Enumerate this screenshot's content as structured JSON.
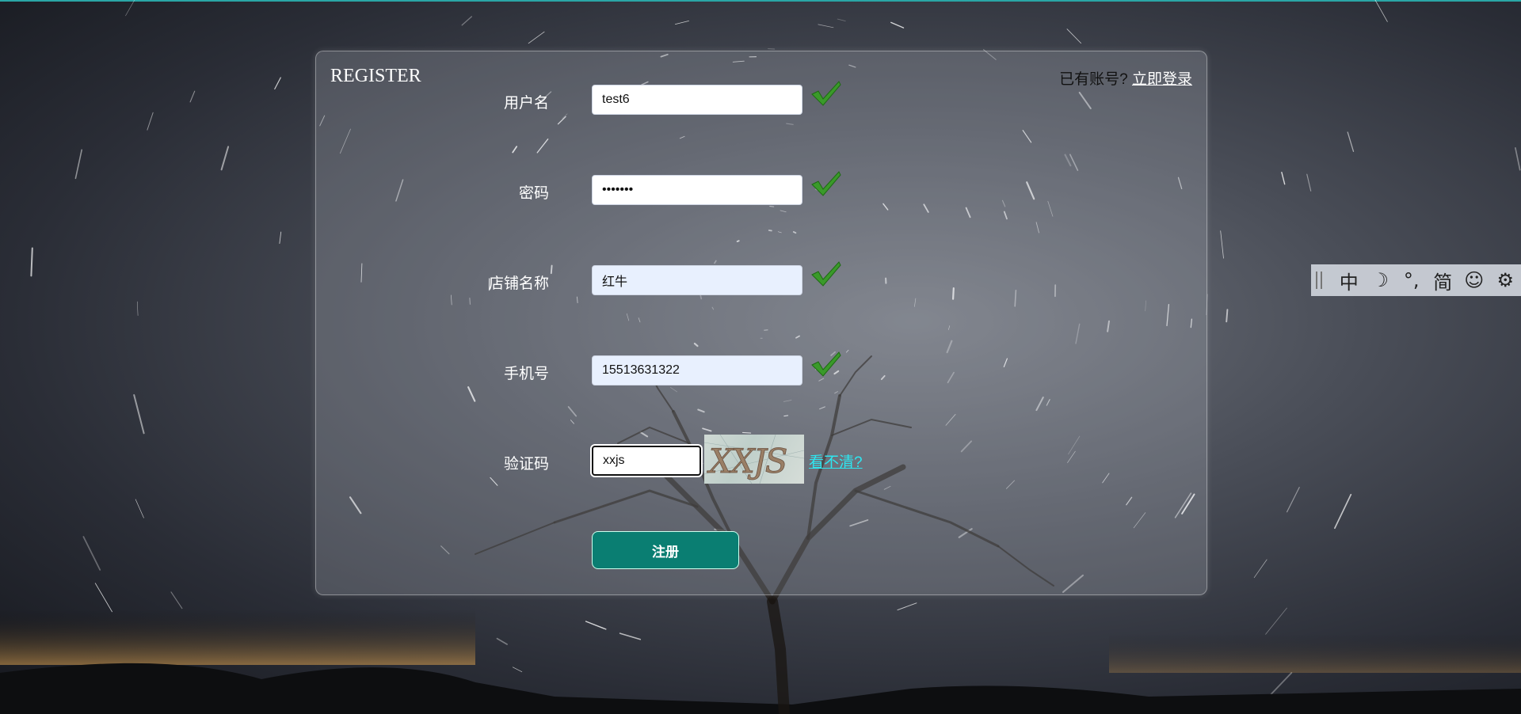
{
  "page": {
    "title": "REGISTER",
    "have_account_text": "已有账号?",
    "login_link": "立即登录"
  },
  "form": {
    "username": {
      "label": "用户名",
      "value": "test6",
      "valid": true
    },
    "password": {
      "label": "密码",
      "value": "•••••••",
      "valid": true
    },
    "shop_name": {
      "label": "店铺名称",
      "value": "红牛",
      "valid": true
    },
    "phone": {
      "label": "手机号",
      "value": "15513631322",
      "valid": true
    },
    "captcha": {
      "label": "验证码",
      "value": "xxjs",
      "image_text": "XXJS",
      "refresh_link": "看不清?"
    },
    "submit_label": "注册"
  },
  "ime_toolbar": {
    "items": [
      "中",
      "☽",
      "°,",
      "简",
      "☺",
      "⚙"
    ],
    "item_names": [
      "chinese-mode-icon",
      "moon-icon",
      "punctuation-icon",
      "simplified-icon",
      "emoji-icon",
      "gear-icon"
    ]
  },
  "colors": {
    "button": "#0a7e72",
    "link_cyan": "#2ee6f0",
    "check_green": "#3a9a2a"
  }
}
